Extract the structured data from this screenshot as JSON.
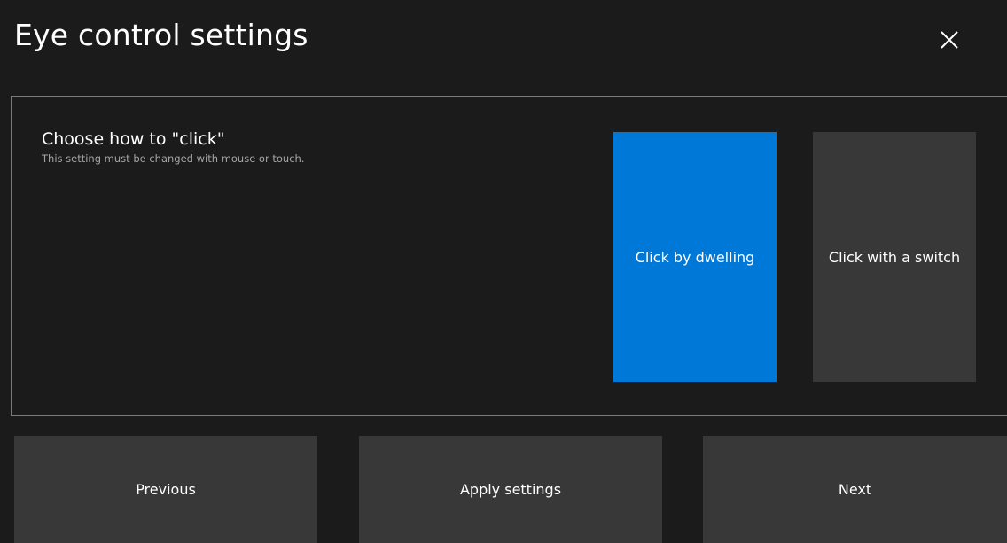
{
  "window": {
    "title": "Eye control settings"
  },
  "close_button": {
    "icon": "close-icon"
  },
  "setting": {
    "title": "Choose how to \"click\"",
    "subtitle": "This setting must be changed with mouse or touch.",
    "options": [
      {
        "label": "Click by dwelling",
        "selected": true
      },
      {
        "label": "Click with a switch",
        "selected": false
      }
    ]
  },
  "footer": {
    "previous_label": "Previous",
    "apply_label": "Apply settings",
    "next_label": "Next"
  },
  "colors": {
    "background": "#1b1b1b",
    "accent": "#0078d7",
    "tile": "#383838",
    "border": "#7a7a7a",
    "subtitle": "#a6a6a6"
  }
}
